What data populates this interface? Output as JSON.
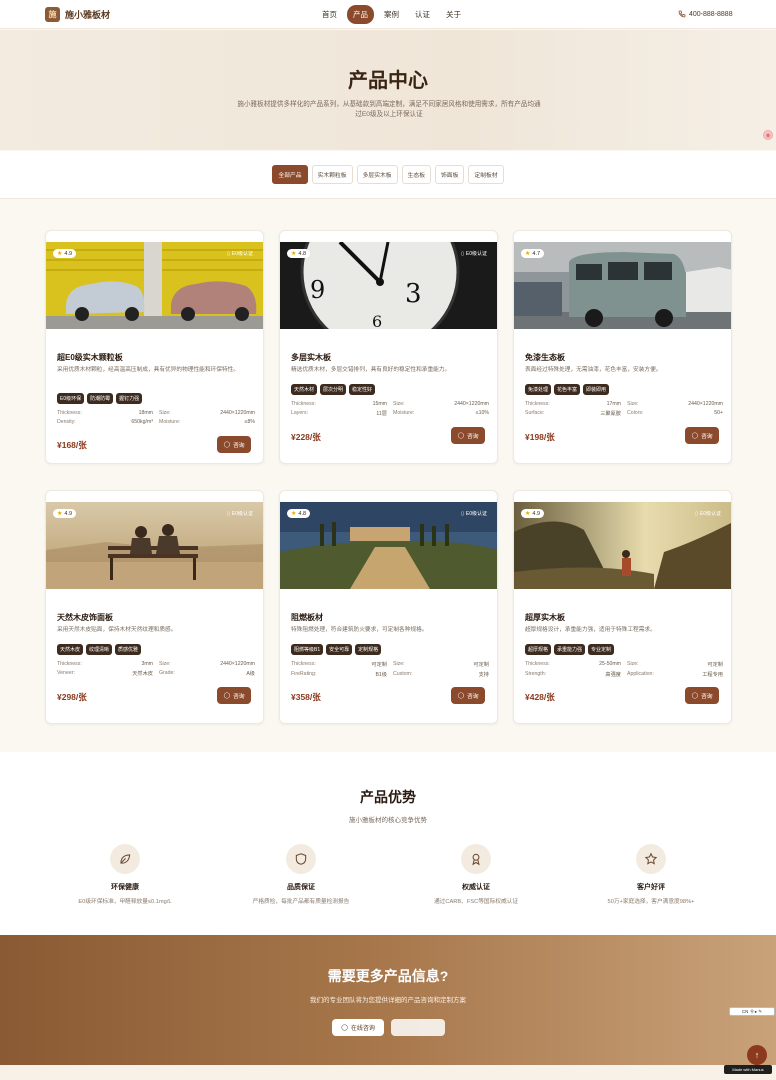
{
  "nav": {
    "logo_mark": "施",
    "brand": "施小雅板材",
    "items": [
      "首页",
      "产品",
      "案例",
      "认证",
      "关于"
    ],
    "active_index": 1,
    "phone": "400-888-8888"
  },
  "hero": {
    "title": "产品中心",
    "desc": "施小雅板材提供多样化的产品系列，从基础款到高端定制，满足不同家居风格和使用需求，所有产品均通过E0级及以上环保认证"
  },
  "filters": [
    "全部产品",
    "实木颗粒板",
    "多层实木板",
    "生态板",
    "饰面板",
    "定制板材"
  ],
  "products": [
    {
      "rating": "4.9",
      "cert": "E0级认证",
      "title": "超E0级实木颗粒板",
      "desc": "采用优质木材颗粒，经高温高压制成，具有优异的物理性能和环保特性。",
      "tags": [
        "E0级环保",
        "防潮防霉",
        "握钉力强"
      ],
      "specs": [
        [
          "Thickness:",
          "18mm"
        ],
        [
          "Size:",
          "2440×1220mm"
        ],
        [
          "Density:",
          "650kg/m³"
        ],
        [
          "Moisture:",
          "≤8%"
        ]
      ],
      "price": "¥168/张",
      "consult": "咨询"
    },
    {
      "rating": "4.8",
      "cert": "E0级认证",
      "title": "多层实木板",
      "desc": "精选优质木材，多层交错排列，具有良好的稳定性和承重能力。",
      "tags": [
        "天然木材",
        "层次分明",
        "稳定性好"
      ],
      "specs": [
        [
          "Thickness:",
          "15mm"
        ],
        [
          "Size:",
          "2440×1220mm"
        ],
        [
          "Layers:",
          "11层"
        ],
        [
          "Moisture:",
          "≤10%"
        ]
      ],
      "price": "¥228/张",
      "consult": "咨询"
    },
    {
      "rating": "4.7",
      "cert": "",
      "title": "免漆生态板",
      "desc": "表面经过特殊处理，无需油漆，花色丰富，安装方便。",
      "tags": [
        "免漆处理",
        "花色丰富",
        "即装即用"
      ],
      "specs": [
        [
          "Thickness:",
          "17mm"
        ],
        [
          "Size:",
          "2440×1220mm"
        ],
        [
          "Surface:",
          "三聚氰胺"
        ],
        [
          "Colors:",
          "50+"
        ]
      ],
      "price": "¥198/张",
      "consult": "咨询"
    },
    {
      "rating": "4.9",
      "cert": "E0级认证",
      "title": "天然木皮饰面板",
      "desc": "采用天然木皮贴面，保持木材天然纹理和质感。",
      "tags": [
        "天然木皮",
        "纹理清晰",
        "质感优雅"
      ],
      "specs": [
        [
          "Thickness:",
          "3mm"
        ],
        [
          "Size:",
          "2440×1220mm"
        ],
        [
          "Veneer:",
          "天然木皮"
        ],
        [
          "Grade:",
          "A级"
        ]
      ],
      "price": "¥298/张",
      "consult": "咨询"
    },
    {
      "rating": "4.8",
      "cert": "E0级认证",
      "title": "阻燃板材",
      "desc": "特殊阻燃处理，符合建筑防火要求，可定制各种规格。",
      "tags": [
        "阻燃等级B1",
        "安全可靠",
        "定制规格"
      ],
      "specs": [
        [
          "Thickness:",
          "可定制"
        ],
        [
          "Size:",
          "可定制"
        ],
        [
          "FireRating:",
          "B1级"
        ],
        [
          "Custom:",
          "支持"
        ]
      ],
      "price": "¥358/张",
      "consult": "咨询"
    },
    {
      "rating": "4.9",
      "cert": "E0级认证",
      "title": "超厚实木板",
      "desc": "超厚规格设计，承重能力强，适用于特殊工程需求。",
      "tags": [
        "超厚规格",
        "承重能力强",
        "专业定制"
      ],
      "specs": [
        [
          "Thickness:",
          "25-50mm"
        ],
        [
          "Size:",
          "可定制"
        ],
        [
          "Strength:",
          "高强度"
        ],
        [
          "Application:",
          "工程专用"
        ]
      ],
      "price": "¥428/张",
      "consult": "咨询"
    }
  ],
  "advantages": {
    "title": "产品优势",
    "subtitle": "施小雅板材的核心竞争优势",
    "items": [
      {
        "icon": "leaf-icon",
        "title": "环保健康",
        "desc": "E0级环保标准，甲醛释放量≤0.1mg/L"
      },
      {
        "icon": "shield-icon",
        "title": "品质保证",
        "desc": "严格质检，每批产品都有质量检测报告"
      },
      {
        "icon": "award-icon",
        "title": "权威认证",
        "desc": "通过CARB、FSC等国际权威认证"
      },
      {
        "icon": "star-icon",
        "title": "客户好评",
        "desc": "50万+家庭选择，客户满意度98%+"
      }
    ]
  },
  "cta": {
    "title": "需要更多产品信息?",
    "desc": "我们的专业团队将为您提供详细的产品咨询和定制方案",
    "btn_consult": "在线咨询",
    "btn_second": ""
  },
  "widgets": {
    "lang": "CN",
    "badge": "Made with Manus",
    "colors": {
      "primary": "#8b4a2b",
      "price": "#8b3a1e",
      "star": "#e6a800"
    }
  }
}
